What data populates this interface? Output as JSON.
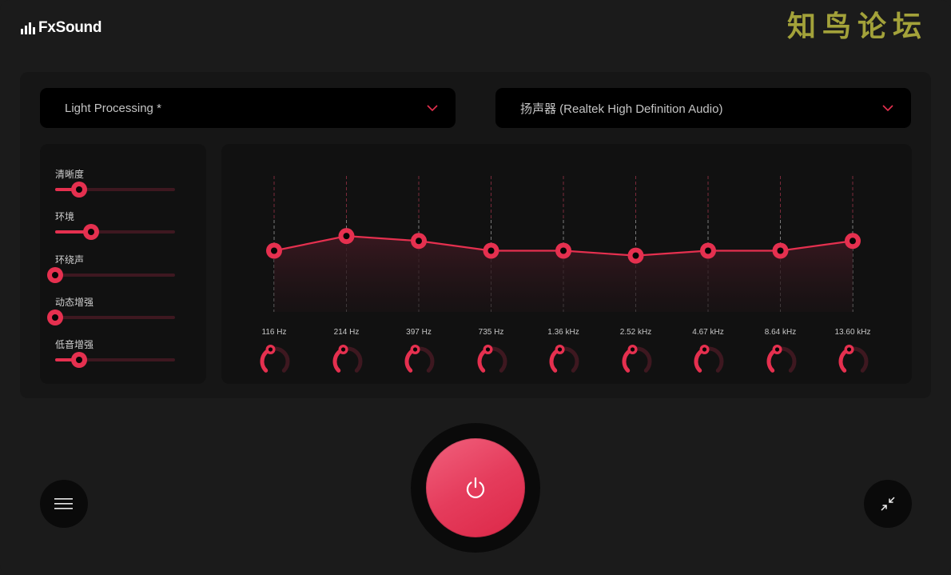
{
  "app": {
    "title": "FxSound",
    "logo_icon": "equalizer-bars-icon",
    "watermark": "知鸟论坛"
  },
  "preset_dropdown": {
    "value": "Light Processing *",
    "icon": "chevron-down-icon"
  },
  "device_dropdown": {
    "value": "扬声器 (Realtek High Definition Audio)",
    "icon": "chevron-down-icon"
  },
  "effects": [
    {
      "label": "清晰度",
      "value": 0.2
    },
    {
      "label": "环境",
      "value": 0.3
    },
    {
      "label": "环绕声",
      "value": 0.0
    },
    {
      "label": "动态增强",
      "value": 0.0
    },
    {
      "label": "低音增强",
      "value": 0.2
    }
  ],
  "equalizer": {
    "bands": [
      {
        "label": "116 Hz",
        "level": 0.5
      },
      {
        "label": "214 Hz",
        "level": 0.62
      },
      {
        "label": "397 Hz",
        "level": 0.58
      },
      {
        "label": "735 Hz",
        "level": 0.5
      },
      {
        "label": "1.36 kHz",
        "level": 0.5
      },
      {
        "label": "2.52 kHz",
        "level": 0.46
      },
      {
        "label": "4.67 kHz",
        "level": 0.5
      },
      {
        "label": "8.64 kHz",
        "level": 0.5
      },
      {
        "label": "13.60 kHz",
        "level": 0.58
      }
    ],
    "accent_color": "#e5304f",
    "inactive_color": "#3e1820"
  },
  "controls": {
    "power": {
      "icon": "power-icon",
      "state": "on"
    },
    "menu": {
      "icon": "hamburger-menu-icon"
    },
    "minimize": {
      "icon": "collapse-arrows-icon"
    }
  }
}
